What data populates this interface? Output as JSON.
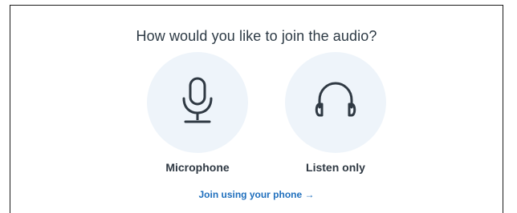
{
  "dialog": {
    "title": "How would you like to join the audio?",
    "options": [
      {
        "label": "Microphone",
        "icon": "microphone-icon"
      },
      {
        "label": "Listen only",
        "icon": "headphones-icon"
      }
    ],
    "phone_link": "Join using your phone →"
  },
  "colors": {
    "circle_bg": "#eef4fa",
    "icon_stroke": "#2f3943",
    "link": "#1f6fbd"
  }
}
